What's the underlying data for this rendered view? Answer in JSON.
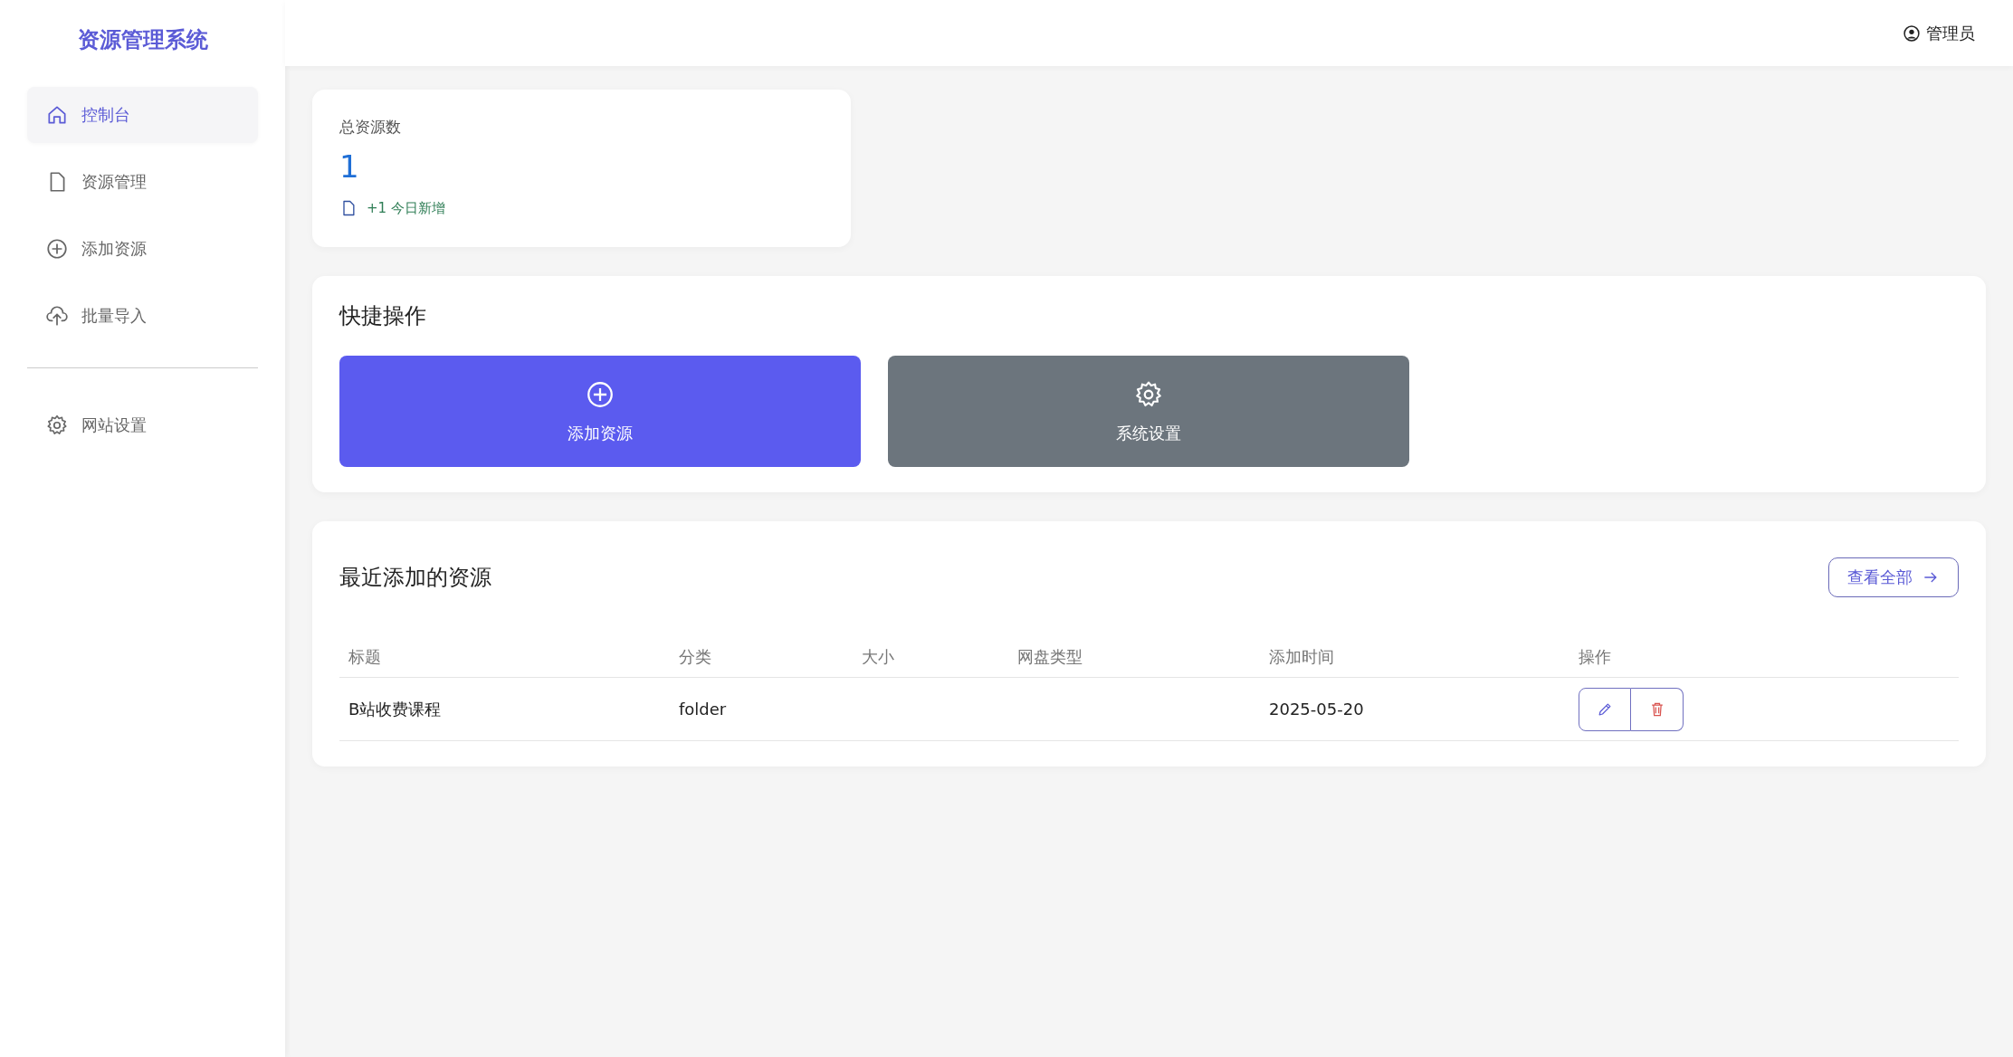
{
  "sidebar": {
    "title": "资源管理系统",
    "items": [
      {
        "label": "控制台",
        "kind": "home",
        "selected": true
      },
      {
        "label": "资源管理",
        "kind": "file",
        "selected": false
      },
      {
        "label": "添加资源",
        "kind": "plus",
        "selected": false
      },
      {
        "label": "批量导入",
        "kind": "upload",
        "selected": false
      },
      {
        "label": "网站设置",
        "kind": "gear",
        "selected": false,
        "divider_before": true
      }
    ]
  },
  "header": {
    "user": "管理员"
  },
  "stat_card": {
    "label": "总资源数",
    "value": "1",
    "note": "+1 今日新增"
  },
  "quick_actions": {
    "title": "快捷操作",
    "buttons": [
      {
        "label": "添加资源",
        "kind": "primary"
      },
      {
        "label": "系统设置",
        "kind": "secondary"
      }
    ]
  },
  "recent": {
    "title": "最近添加的资源",
    "view_all": "查看全部",
    "columns": [
      "标题",
      "分类",
      "大小",
      "网盘类型",
      "添加时间",
      "操作"
    ],
    "rows": [
      {
        "cells": [
          "B站收费课程",
          "folder",
          "",
          "",
          "2025-05-20"
        ]
      }
    ]
  }
}
